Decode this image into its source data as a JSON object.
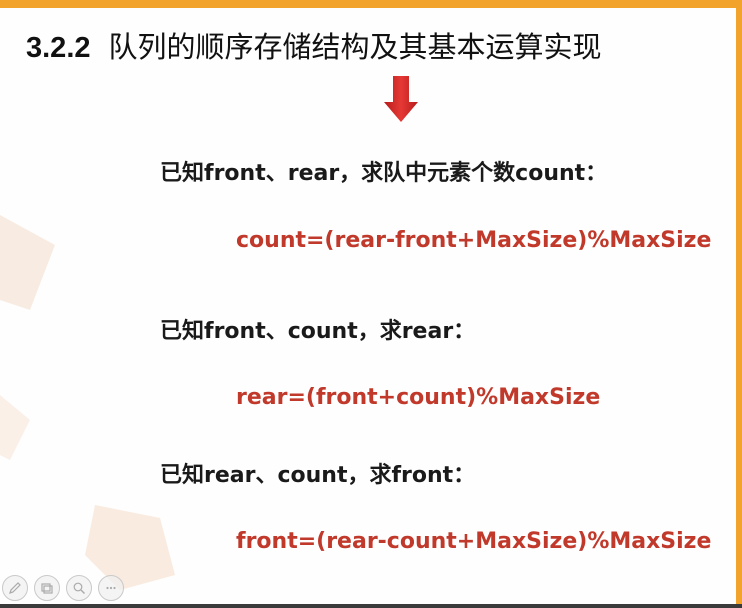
{
  "slide": {
    "section_number": "3.2.2",
    "title": "队列的顺序存储结构及其基本运算实现"
  },
  "items": [
    {
      "question": "已知front、rear，求队中元素个数count：",
      "formula": "count=(rear-front+MaxSize)%MaxSize"
    },
    {
      "question": "已知front、count，求rear：",
      "formula": "rear=(front+count)%MaxSize"
    },
    {
      "question": "已知rear、count，求front：",
      "formula": "front=(rear-count+MaxSize)%MaxSize"
    }
  ],
  "toolbar": {
    "buttons": [
      {
        "icon": "pen-icon"
      },
      {
        "icon": "slides-icon"
      },
      {
        "icon": "zoom-icon"
      },
      {
        "icon": "more-icon"
      }
    ]
  },
  "colors": {
    "accent": "#f2a32b",
    "formula": "#c0392b",
    "arrow": "#c62828"
  }
}
